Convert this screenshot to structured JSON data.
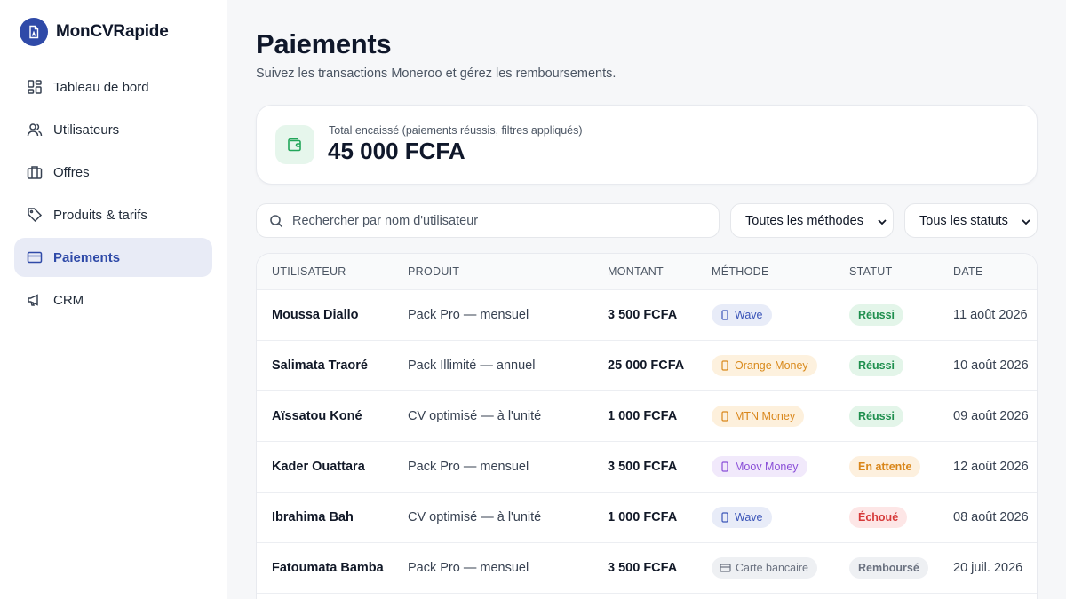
{
  "app": {
    "name": "MonCVRapide",
    "logo_icon": "file-user-icon"
  },
  "nav": [
    {
      "label": "Tableau de bord",
      "icon": "dashboard-icon",
      "active": false
    },
    {
      "label": "Utilisateurs",
      "icon": "users-icon",
      "active": false
    },
    {
      "label": "Offres",
      "icon": "briefcase-icon",
      "active": false
    },
    {
      "label": "Produits & tarifs",
      "icon": "tag-icon",
      "active": false
    },
    {
      "label": "Paiements",
      "icon": "credit-card-icon",
      "active": true
    },
    {
      "label": "CRM",
      "icon": "megaphone-icon",
      "active": false
    }
  ],
  "page": {
    "title": "Paiements",
    "subtitle": "Suivez les transactions Moneroo et gérez les remboursements."
  },
  "summary": {
    "label": "Total encaissé (paiements réussis, filtres appliqués)",
    "value": "45 000 FCFA",
    "icon": "wallet-icon"
  },
  "filters": {
    "search_placeholder": "Rechercher par nom d'utilisateur",
    "method": "Toutes les méthodes",
    "status": "Tous les statuts"
  },
  "table": {
    "headers": [
      "UTILISATEUR",
      "PRODUIT",
      "MONTANT",
      "MÉTHODE",
      "STATUT",
      "DATE"
    ],
    "rows": [
      {
        "user": "Moussa Diallo",
        "product": "Pack Pro — mensuel",
        "amount": "3 500 FCFA",
        "method": "Wave",
        "method_kind": "wave",
        "status": "Réussi",
        "status_kind": "success",
        "date": "11 août 2026"
      },
      {
        "user": "Salimata Traoré",
        "product": "Pack Illimité — annuel",
        "amount": "25 000 FCFA",
        "method": "Orange Money",
        "method_kind": "orange",
        "status": "Réussi",
        "status_kind": "success",
        "date": "10 août 2026"
      },
      {
        "user": "Aïssatou Koné",
        "product": "CV optimisé — à l'unité",
        "amount": "1 000 FCFA",
        "method": "MTN Money",
        "method_kind": "mtn",
        "status": "Réussi",
        "status_kind": "success",
        "date": "09 août 2026"
      },
      {
        "user": "Kader Ouattara",
        "product": "Pack Pro — mensuel",
        "amount": "3 500 FCFA",
        "method": "Moov Money",
        "method_kind": "moov",
        "status": "En attente",
        "status_kind": "pending",
        "date": "12 août 2026"
      },
      {
        "user": "Ibrahima Bah",
        "product": "CV optimisé — à l'unité",
        "amount": "1 000 FCFA",
        "method": "Wave",
        "method_kind": "wave",
        "status": "Échoué",
        "status_kind": "failed",
        "date": "08 août 2026"
      },
      {
        "user": "Fatoumata Bamba",
        "product": "Pack Pro — mensuel",
        "amount": "3 500 FCFA",
        "method": "Carte bancaire",
        "method_kind": "card",
        "status": "Remboursé",
        "status_kind": "refunded",
        "date": "20 juil. 2026"
      }
    ]
  },
  "colors": {
    "brand": "#2f4aa8",
    "wave_bg": "#e8ecf8",
    "wave_fg": "#3b55b8",
    "orange_bg": "#fdf1de",
    "orange_fg": "#d98a1c",
    "mtn_bg": "#fdf0dc",
    "mtn_fg": "#d9861a",
    "moov_bg": "#f1e9fb",
    "moov_fg": "#8a4fd8",
    "card_bg": "#eef0f3",
    "card_fg": "#6b7280",
    "success_bg": "#e3f5e9",
    "success_fg": "#1f8f4e",
    "pending_bg": "#fdf0de",
    "pending_fg": "#d9861a",
    "failed_bg": "#fde6e6",
    "failed_fg": "#d63a3a",
    "refunded_bg": "#eef0f3",
    "refunded_fg": "#6b7280"
  }
}
